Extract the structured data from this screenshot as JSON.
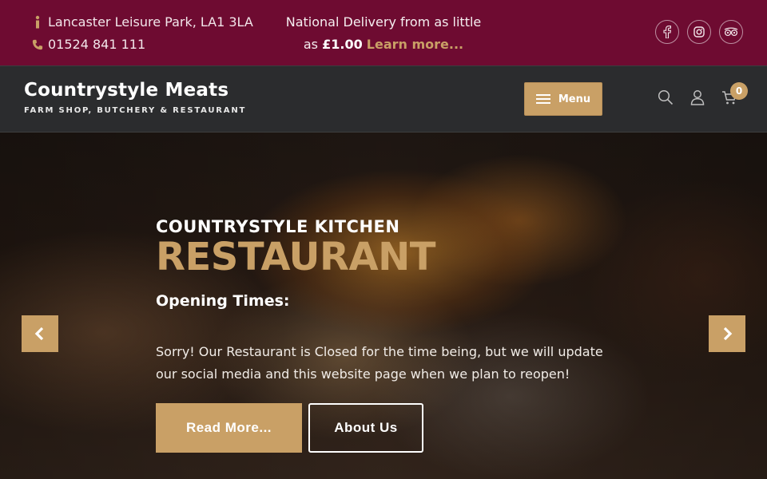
{
  "topbar": {
    "address": "Lancaster Leisure Park, LA1 3LA",
    "phone": "01524 841 111",
    "delivery_line1": "National Delivery from as little",
    "delivery_as": "as",
    "delivery_price": "£1.00",
    "delivery_link": "Learn more...",
    "social": [
      "facebook-icon",
      "instagram-icon",
      "tripadvisor-icon"
    ]
  },
  "header": {
    "logo_title": "Countrystyle Meats",
    "logo_subtitle": "FARM SHOP, BUTCHERY & RESTAURANT",
    "menu_label": "Menu",
    "cart_count": "0"
  },
  "hero": {
    "eyebrow": "COUNTRYSTYLE KITCHEN",
    "title": "RESTAURANT",
    "opening_heading": "Opening Times:",
    "description": "Sorry! Our Restaurant is Closed for the time being, but we will update our social media and this website page when we plan to reopen!",
    "primary_button": "Read More...",
    "secondary_button": "About Us"
  },
  "colors": {
    "topbar_bg": "#6e0b31",
    "header_bg": "#2b2c2e",
    "accent_gold": "#c9a066"
  }
}
